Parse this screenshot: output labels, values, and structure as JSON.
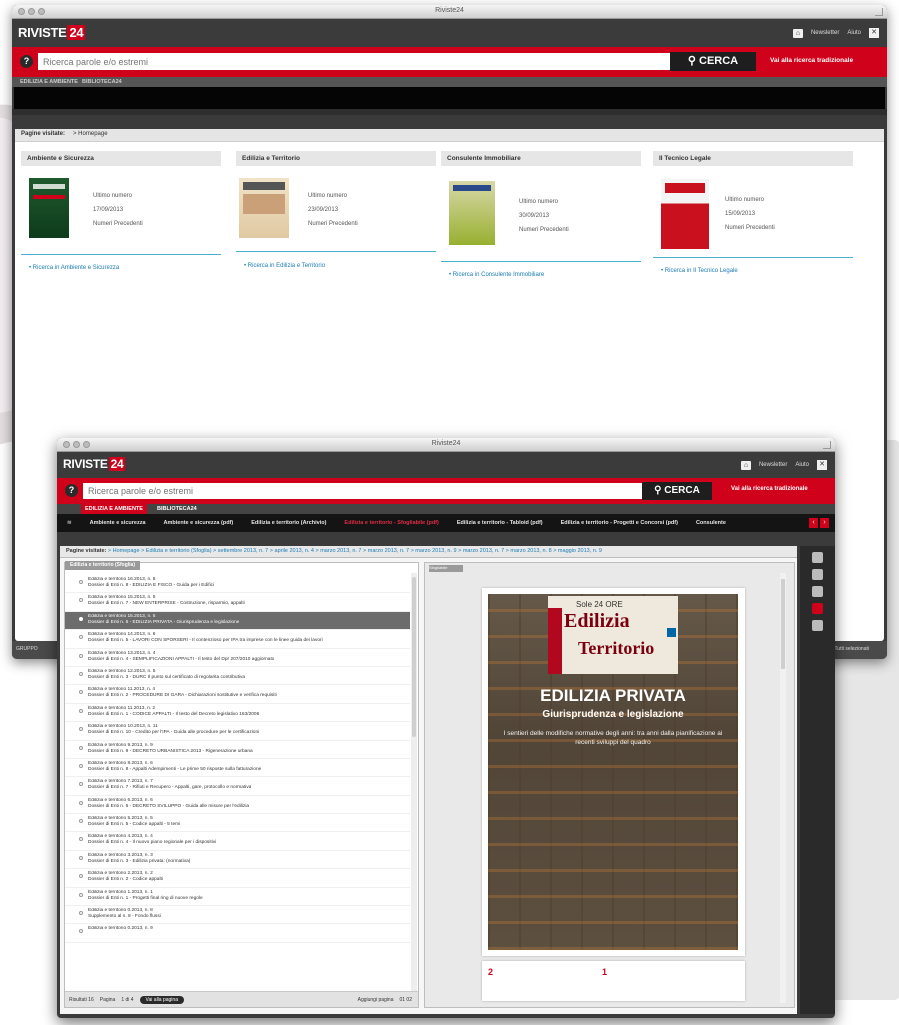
{
  "window1": {
    "title": "Riviste24",
    "logo": {
      "text": "RIVISTE",
      "num": "24"
    },
    "top_links": [
      "Newsletter",
      "Aiuto"
    ],
    "search": {
      "placeholder": "Ricerca parole e/o estremi",
      "button": "CERCA",
      "advanced_link": "Vai alla ricerca tradizionale"
    },
    "tabs": [
      "EDILIZIA E AMBIENTE",
      "BIBLIOTECA24"
    ],
    "breadcrumb": {
      "label": "Pagine visitate:",
      "item": "> Homepage"
    },
    "magazines": [
      {
        "title": "Ambiente e Sicurezza",
        "last_label": "Ultimo numero",
        "date": "17/09/2013",
        "prev": "Numeri Precedenti",
        "link": "Ricerca in Ambiente e Sicurezza"
      },
      {
        "title": "Edilizia e Territorio",
        "last_label": "Ultimo numero",
        "date": "23/09/2013",
        "prev": "Numeri Precedenti",
        "link": "Ricerca in Edilizia e Territorio"
      },
      {
        "title": "Consulente Immobiliare",
        "last_label": "Ultimo numero",
        "date": "30/09/2013",
        "prev": "Numeri Precedenti",
        "link": "Ricerca in Consulente Immobiliare"
      },
      {
        "title": "Il Tecnico Legale",
        "last_label": "Ultimo numero",
        "date": "15/09/2013",
        "prev": "Numeri Precedenti",
        "link": "Ricerca in Il Tecnico Legale"
      }
    ],
    "footer": {
      "brand": "GRUPPO",
      "right": "Tutti selezionati"
    }
  },
  "window2": {
    "title": "Riviste24",
    "logo": {
      "text": "RIVISTE",
      "num": "24"
    },
    "top_links": [
      "Newsletter",
      "Aiuto"
    ],
    "search": {
      "placeholder": "Ricerca parole e/o estremi",
      "button": "CERCA",
      "advanced_link": "Vai alla ricerca tradizionale"
    },
    "tabs": [
      "EDILIZIA E AMBIENTE",
      "BIBLIOTECA24"
    ],
    "subnav": [
      "Ambiente e sicurezza",
      "Ambiente e sicurezza (pdf)",
      "Edilizia e territorio (Archivio)",
      "Edilizia e territorio - Sfogliabile (pdf)",
      "Edilizia e territorio - Tabloid (pdf)",
      "Edilizia e territorio - Progetti e Concorsi (pdf)",
      "Consulente"
    ],
    "breadcrumb": {
      "label": "Pagine visitate:",
      "path": "> Homepage > Edilizia e territorio (Sfoglia) > settembre 2013, n. 7 > aprile 2013, n. 4 > marzo 2013, n. 7 > marzo 2013, n. 7 > marzo 2013, n. 9 > marzo 2013, n. 7 > marzo 2013, n. 8 > maggio 2013, n. 9"
    },
    "list_tab": "Edilizia e territorio (Sfoglia)",
    "viewer_tab": "Sfogliabile",
    "items": [
      {
        "t1": "Edilizia e territorio 16.2013, n. 8",
        "t2": "Dossier di Enti n. 8 - EDILIZIA E FISCO - Guida per i Edifici"
      },
      {
        "t1": "Edilizia e territorio 15.2013, n. 5",
        "t2": "Dossier di Enti n. 7 - NEW ENTERPRISE - Costruzione, risparmio, appalti"
      },
      {
        "t1": "Edilizia e territorio 15.2013, n. 5",
        "t2": "Dossier di Enti n. 6 - EDILIZIA PRIVATA - Giurisprudenza e legislazione"
      },
      {
        "t1": "Edilizia e territorio 14.2013, n. 6",
        "t2": "Dossier di Enti n. 5 - LAVORI CON SPORSERI - Il contenzioso per IPA tra imprese con le linee guida dei lavori"
      },
      {
        "t1": "Edilizia e territorio 13.2013, n. 4",
        "t2": "Dossier di Enti n. 4 - SEMPLIFICAZIONI APPALTI - Il testo del Dpr 207/2010 aggiornato"
      },
      {
        "t1": "Edilizia e territorio 12.2013, n. 5",
        "t2": "Dossier di Enti n. 3 - DURC Il punto sul certificato di regolarita contributiva"
      },
      {
        "t1": "Edilizia e territorio 11.2013, n. 4",
        "t2": "Dossier di Enti n. 2 - PROCEDURE DI GARA - Dichiarazioni sostitutive e verifica requisiti"
      },
      {
        "t1": "Edilizia e territorio 11.2013, n. 2",
        "t2": "Dossier di Enti n. 1 - CODICE APPALTI - Il testo del Decreto legislativo 163/2006"
      },
      {
        "t1": "Edilizia e territorio 10.2013, n. 11",
        "t2": "Dossier di Enti n. 10 - Credito per l'IPA - Guida alle procedure per le certificazioni"
      },
      {
        "t1": "Edilizia e territorio 9.2013, n. 9",
        "t2": "Dossier di Enti n. 9 - DECRETO URBANISTICA 2013 - Rigenerazione urbana"
      },
      {
        "t1": "Edilizia e territorio 8.2013, n. 6",
        "t2": "Dossier di Enti n. 8 - Appalti Adempimenti - Le prime 50 risposte sulla fatturazione"
      },
      {
        "t1": "Edilizia e territorio 7.2013, n. 7",
        "t2": "Dossier di Enti n. 7 - Rifiuti e Recupero - Appalti, gare, protocollo e normativa"
      },
      {
        "t1": "Edilizia e territorio 6.2013, n. 6",
        "t2": "Dossier di Enti n. 6 - DECRETO SVILUPPO - Guida alle misure per l'edilizia"
      },
      {
        "t1": "Edilizia e territorio 5.2013, n. 5",
        "t2": "Dossier di Enti n. 5 - Codice appalti - 5 temi"
      },
      {
        "t1": "Edilizia e territorio 4.2013, n. 4",
        "t2": "Dossier di Enti n. 4 - Il nuovo piano regionale per i dispositivi"
      },
      {
        "t1": "Edilizia e territorio 3.2013, n. 3",
        "t2": "Dossier di Enti n. 3 - Edilizia privata: (normativa)"
      },
      {
        "t1": "Edilizia e territorio 2.2013, n. 2",
        "t2": "Dossier di Enti n. 2 - Codice appalti"
      },
      {
        "t1": "Edilizia e territorio 1.2013, n. 1",
        "t2": "Dossier di Enti n. 1 - Progetti final ring di nuove regole"
      },
      {
        "t1": "Edilizia e territorio 0.2013, n. 8",
        "t2": "Supplemento al n. 8 - Fondo flussi"
      },
      {
        "t1": "Edilizia e territorio 0.2013, n. 9",
        "t2": ""
      }
    ],
    "pager": {
      "results": "Risultati 16",
      "page_label": "Pagina",
      "of": "1 di 4",
      "goto": "Vai alla pagina",
      "add": "Aggiungi pagina",
      "pages": "01 02"
    },
    "magazine": {
      "brand": "Sole 24 ORE",
      "word1": "Edilizia",
      "word2": "Territorio",
      "headline": "EDILIZIA PRIVATA",
      "subhead": "Giurisprudenza e legislazione",
      "text": "I sentieri delle modifiche normative degli anni: tra anni dalla pianificazione ai recenti sviluppi del quadro",
      "next_page_num": "2",
      "next_page_num2": "1"
    }
  }
}
